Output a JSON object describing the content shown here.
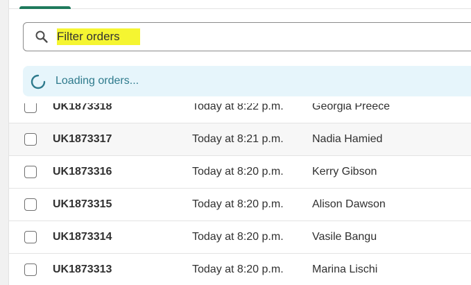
{
  "search": {
    "placeholder": "Filter orders",
    "icon": "search-icon"
  },
  "loading": {
    "text": "Loading orders...",
    "icon": "spinner-icon"
  },
  "orders": [
    {
      "order": "UK1873318",
      "date": "Today at 8:22 p.m.",
      "customer": "Georgia Preece"
    },
    {
      "order": "UK1873317",
      "date": "Today at 8:21 p.m.",
      "customer": "Nadia Hamied"
    },
    {
      "order": "UK1873316",
      "date": "Today at 8:20 p.m.",
      "customer": "Kerry Gibson"
    },
    {
      "order": "UK1873315",
      "date": "Today at 8:20 p.m.",
      "customer": "Alison Dawson"
    },
    {
      "order": "UK1873314",
      "date": "Today at 8:20 p.m.",
      "customer": "Vasile Bangu"
    },
    {
      "order": "UK1873313",
      "date": "Today at 8:20 p.m.",
      "customer": "Marina Lischi"
    }
  ],
  "colors": {
    "active_tab": "#1f7a5c",
    "highlight": "#f5f531",
    "banner_bg": "#e6f5fb",
    "banner_text": "#2e7a8c"
  }
}
